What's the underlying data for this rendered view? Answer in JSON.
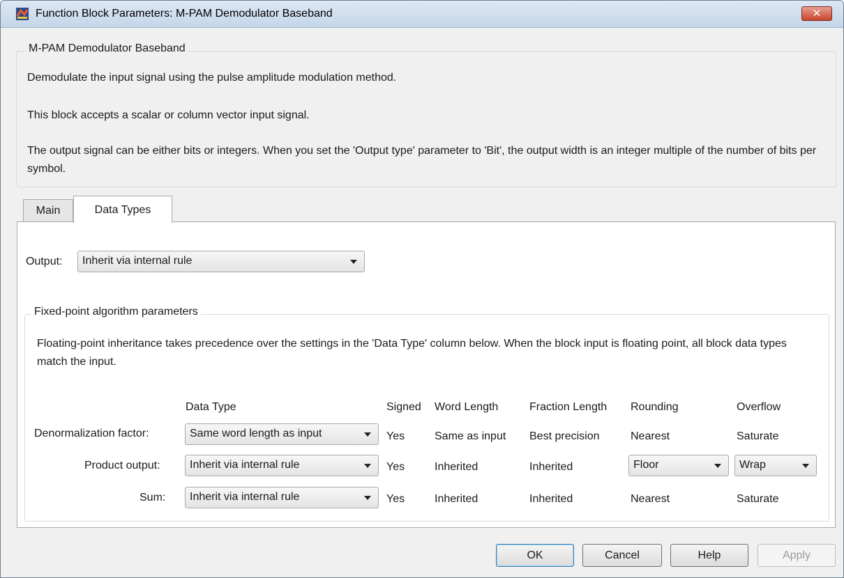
{
  "window": {
    "title": "Function Block Parameters: M-PAM Demodulator Baseband",
    "close_label": "✕"
  },
  "description": {
    "group_title": "M-PAM Demodulator Baseband",
    "para1": "Demodulate the input signal using the pulse amplitude modulation method.",
    "para2": "This block accepts a scalar or column vector input signal.",
    "para3": "The output signal can be either bits or integers. When you set the 'Output type' parameter to 'Bit', the output width is an integer multiple of the number of bits per symbol."
  },
  "tabs": [
    {
      "label": "Main",
      "active": false
    },
    {
      "label": "Data Types",
      "active": true
    }
  ],
  "output": {
    "label": "Output:",
    "value": "Inherit via internal rule"
  },
  "fixed_point": {
    "group_title": "Fixed-point algorithm parameters",
    "note": "Floating-point inheritance takes precedence over the settings in the 'Data Type' column below. When the block input is floating point, all block data types match the input.",
    "headers": {
      "data_type": "Data Type",
      "signed": "Signed",
      "word_length": "Word Length",
      "fraction_length": "Fraction Length",
      "rounding": "Rounding",
      "overflow": "Overflow"
    },
    "rows": [
      {
        "label": "Denormalization factor:",
        "data_type": "Same word length as input",
        "signed": "Yes",
        "word_length": "Same as input",
        "fraction_length": "Best precision",
        "rounding": "Nearest",
        "overflow": "Saturate"
      },
      {
        "label": "Product output:",
        "data_type": "Inherit via internal rule",
        "signed": "Yes",
        "word_length": "Inherited",
        "fraction_length": "Inherited",
        "rounding": "Floor",
        "overflow": "Wrap"
      },
      {
        "label": "Sum:",
        "data_type": "Inherit via internal rule",
        "signed": "Yes",
        "word_length": "Inherited",
        "fraction_length": "Inherited",
        "rounding": "Nearest",
        "overflow": "Saturate"
      }
    ]
  },
  "buttons": {
    "ok": "OK",
    "cancel": "Cancel",
    "help": "Help",
    "apply": "Apply"
  }
}
